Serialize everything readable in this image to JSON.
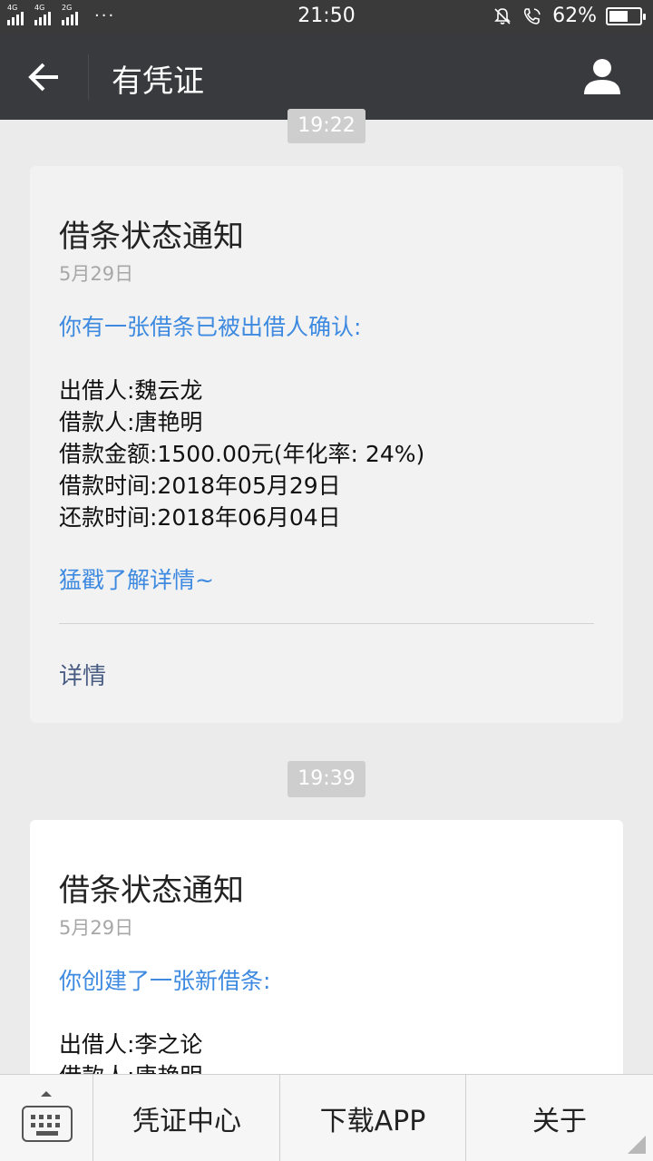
{
  "status_bar": {
    "network_labels": [
      "4G",
      "4G",
      "2G"
    ],
    "more": "···",
    "time": "21:50",
    "battery": "62%",
    "battery_level": 0.62
  },
  "header": {
    "title": "有凭证"
  },
  "messages": [
    {
      "time": "19:22",
      "title": "借条状态通知",
      "date": "5月29日",
      "intro": "你有一张借条已被出借人确认:",
      "rows": [
        "出借人:魏云龙",
        "借款人:唐艳明",
        "借款金额:1500.00元(年化率: 24%)",
        "借款时间:2018年05月29日",
        "还款时间:2018年06月04日"
      ],
      "more": "猛戳了解详情~",
      "details": "详情"
    },
    {
      "time": "19:39",
      "title": "借条状态通知",
      "date": "5月29日",
      "intro": "你创建了一张新借条:",
      "rows": [
        "出借人:李之论",
        "借款人:唐艳明"
      ]
    }
  ],
  "bottom_bar": {
    "tabs": [
      "凭证中心",
      "下载APP",
      "关于"
    ]
  }
}
